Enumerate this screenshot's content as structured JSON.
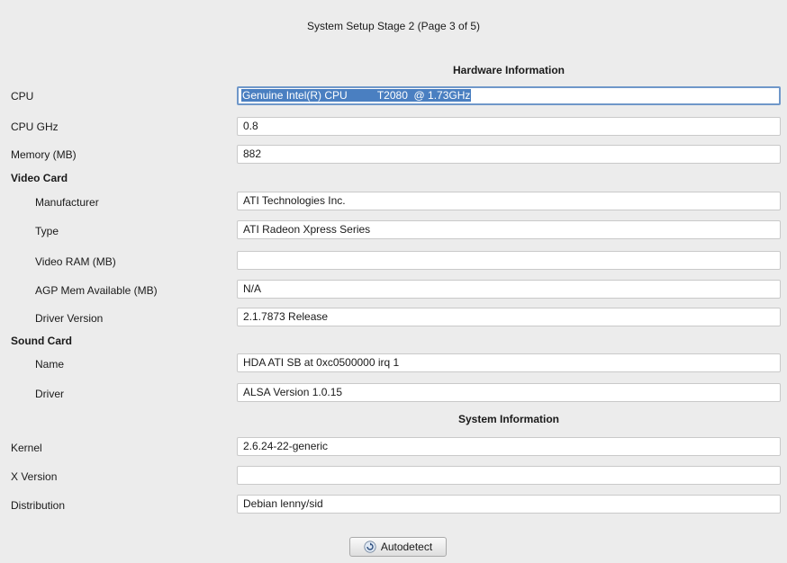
{
  "window": {
    "title": "System Setup Stage 2 (Page 3 of 5)"
  },
  "hardware": {
    "heading": "Hardware Information",
    "cpu": {
      "label": "CPU",
      "value": "Genuine Intel(R) CPU          T2080  @ 1.73GHz"
    },
    "cpu_ghz": {
      "label": "CPU GHz",
      "value": "0.8"
    },
    "memory": {
      "label": "Memory (MB)",
      "value": "882"
    },
    "video_card": {
      "label": "Video Card",
      "manufacturer": {
        "label": "Manufacturer",
        "value": "ATI Technologies Inc."
      },
      "type": {
        "label": "Type",
        "value": "ATI Radeon Xpress Series"
      },
      "video_ram": {
        "label": "Video RAM (MB)",
        "value": ""
      },
      "agp_mem": {
        "label": "AGP Mem Available (MB)",
        "value": "N/A"
      },
      "driver_version": {
        "label": "Driver Version",
        "value": "2.1.7873 Release"
      }
    },
    "sound_card": {
      "label": "Sound Card",
      "name": {
        "label": "Name",
        "value": "HDA ATI SB at 0xc0500000 irq 1"
      },
      "driver": {
        "label": "Driver",
        "value": "ALSA Version 1.0.15"
      }
    }
  },
  "system": {
    "heading": "System Information",
    "kernel": {
      "label": "Kernel",
      "value": "2.6.24-22-generic"
    },
    "x_version": {
      "label": "X Version",
      "value": ""
    },
    "distribution": {
      "label": "Distribution",
      "value": "Debian lenny/sid"
    }
  },
  "actions": {
    "autodetect_label": "Autodetect",
    "autodetect_icon": "refresh-icon"
  },
  "colors": {
    "background": "#ececec",
    "selection": "#4a7fc1",
    "focus_border": "#6f97c9"
  }
}
